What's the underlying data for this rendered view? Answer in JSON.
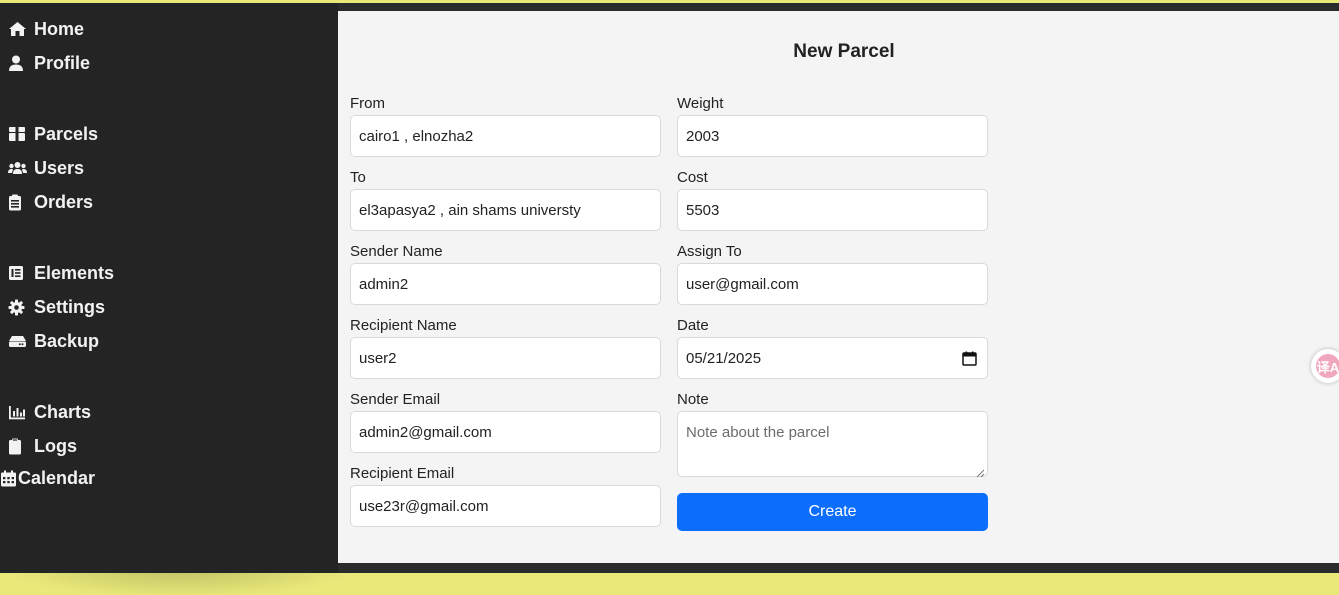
{
  "sidebar": {
    "items": [
      {
        "label": "Home",
        "icon": "home-icon"
      },
      {
        "label": "Profile",
        "icon": "user-icon"
      },
      {
        "label": "Parcels",
        "icon": "box-icon"
      },
      {
        "label": "Users",
        "icon": "users-icon"
      },
      {
        "label": "Orders",
        "icon": "clipboard-list-icon"
      },
      {
        "label": "Elements",
        "icon": "list-box-icon"
      },
      {
        "label": "Settings",
        "icon": "gear-icon"
      },
      {
        "label": "Backup",
        "icon": "hard-drive-icon"
      },
      {
        "label": "Charts",
        "icon": "bar-chart-icon"
      },
      {
        "label": "Logs",
        "icon": "clipboard-icon"
      },
      {
        "label": "Calendar",
        "icon": "calendar-icon"
      }
    ]
  },
  "form": {
    "title": "New Parcel",
    "from": {
      "label": "From",
      "value": "cairo1 , elnozha2"
    },
    "to": {
      "label": "To",
      "value": "el3apasya2 , ain shams universty"
    },
    "sender_name": {
      "label": "Sender Name",
      "value": "admin2"
    },
    "recipient_name": {
      "label": "Recipient Name",
      "value": "user2"
    },
    "sender_email": {
      "label": "Sender Email",
      "value": "admin2@gmail.com"
    },
    "recipient_email": {
      "label": "Recipient Email",
      "value": "use23r@gmail.com"
    },
    "weight": {
      "label": "Weight",
      "value": "2003"
    },
    "cost": {
      "label": "Cost",
      "value": "5503"
    },
    "assign_to": {
      "label": "Assign To",
      "value": "user@gmail.com"
    },
    "date": {
      "label": "Date",
      "value": "05/21/2025"
    },
    "note": {
      "label": "Note",
      "placeholder": "Note about the parcel"
    },
    "submit_label": "Create"
  },
  "overlay": {
    "translate_icon": "translate-icon",
    "translate_glyph": "译A"
  },
  "colors": {
    "sidebar_bg": "#242424",
    "main_bg": "#f4f4f4",
    "primary": "#0d6efd",
    "page_bg": "#e9e97a"
  }
}
